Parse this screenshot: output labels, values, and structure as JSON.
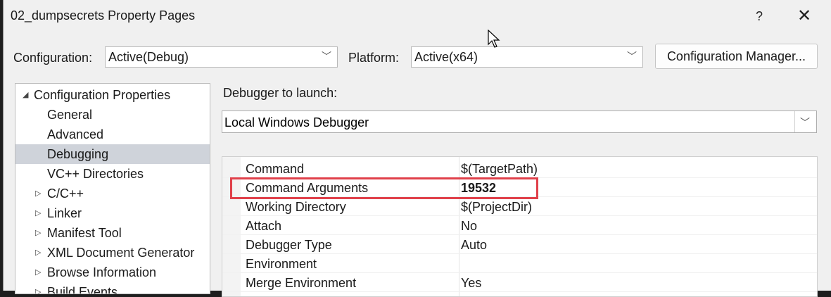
{
  "window": {
    "title": "02_dumpsecrets Property Pages",
    "help_glyph": "?",
    "close_glyph": "✕"
  },
  "toolbar": {
    "configuration_label": "Configuration:",
    "configuration_value": "Active(Debug)",
    "platform_label": "Platform:",
    "platform_value": "Active(x64)",
    "config_manager_label": "Configuration Manager..."
  },
  "tree": {
    "items": [
      {
        "label": "Configuration Properties",
        "arrow": "◢"
      },
      {
        "label": "General"
      },
      {
        "label": "Advanced"
      },
      {
        "label": "Debugging",
        "selected": true
      },
      {
        "label": "VC++ Directories"
      },
      {
        "label": "C/C++",
        "arrow": "▷"
      },
      {
        "label": "Linker",
        "arrow": "▷"
      },
      {
        "label": "Manifest Tool",
        "arrow": "▷"
      },
      {
        "label": "XML Document Generator",
        "arrow": "▷"
      },
      {
        "label": "Browse Information",
        "arrow": "▷"
      },
      {
        "label": "Build Events",
        "arrow": "▷"
      }
    ]
  },
  "debugger": {
    "label": "Debugger to launch:",
    "value": "Local Windows Debugger"
  },
  "properties": [
    {
      "name": "Command",
      "value": "$(TargetPath)"
    },
    {
      "name": "Command Arguments",
      "value": "19532",
      "bold": true
    },
    {
      "name": "Working Directory",
      "value": "$(ProjectDir)"
    },
    {
      "name": "Attach",
      "value": "No"
    },
    {
      "name": "Debugger Type",
      "value": "Auto"
    },
    {
      "name": "Environment",
      "value": ""
    },
    {
      "name": "Merge Environment",
      "value": "Yes"
    }
  ],
  "colors": {
    "highlight": "#e0404a",
    "selected_row": "#cfd3da",
    "dialog_bg": "#f0f0f0"
  }
}
